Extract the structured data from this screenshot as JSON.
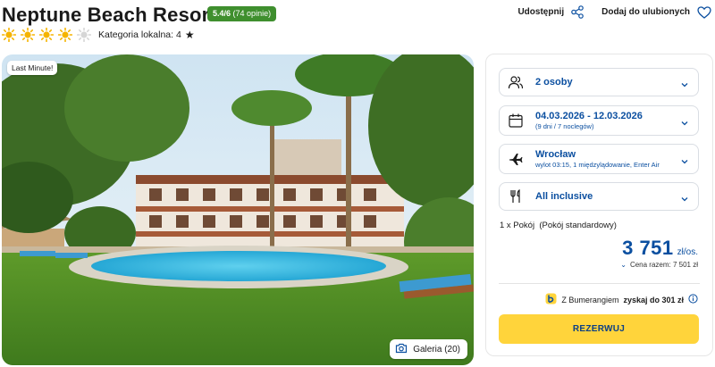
{
  "header": {
    "hotel_name": "Neptune Beach Resort",
    "rating": "5.4/6",
    "reviews": "(74 opinie)",
    "stars": 4,
    "max_stars": 5,
    "local_category": "Kategoria lokalna: 4",
    "share_label": "Udostępnij",
    "favorite_label": "Dodaj do ulubionych"
  },
  "gallery": {
    "badge": "Last Minute!",
    "gallery_label": "Galeria (20)"
  },
  "booking": {
    "persons": "2 osoby",
    "dates": "04.03.2026 - 12.03.2026",
    "dates_sub": "(9 dni / 7 noclegów)",
    "departure_city": "Wrocław",
    "flight_sub": "wylot 03:15, 1 międzylądowanie, Enter Air",
    "board": "All inclusive",
    "room_qty": "1 x Pokój",
    "room_type": "(Pokój standardowy)",
    "price": "3 751",
    "price_unit": "zł/os.",
    "total": "Cena razem: 7 501 zł",
    "bumerang_prefix": "Z Bumerangiem",
    "bumerang_bold": "zyskaj do 301 zł",
    "book_label": "REZERWUJ"
  },
  "colors": {
    "accent_blue": "#0b4fa0",
    "rating_green": "#3f8f2e",
    "book_yellow": "#ffd43b",
    "sun_active": "#f5b400",
    "sun_inactive": "#d6d6d6"
  }
}
